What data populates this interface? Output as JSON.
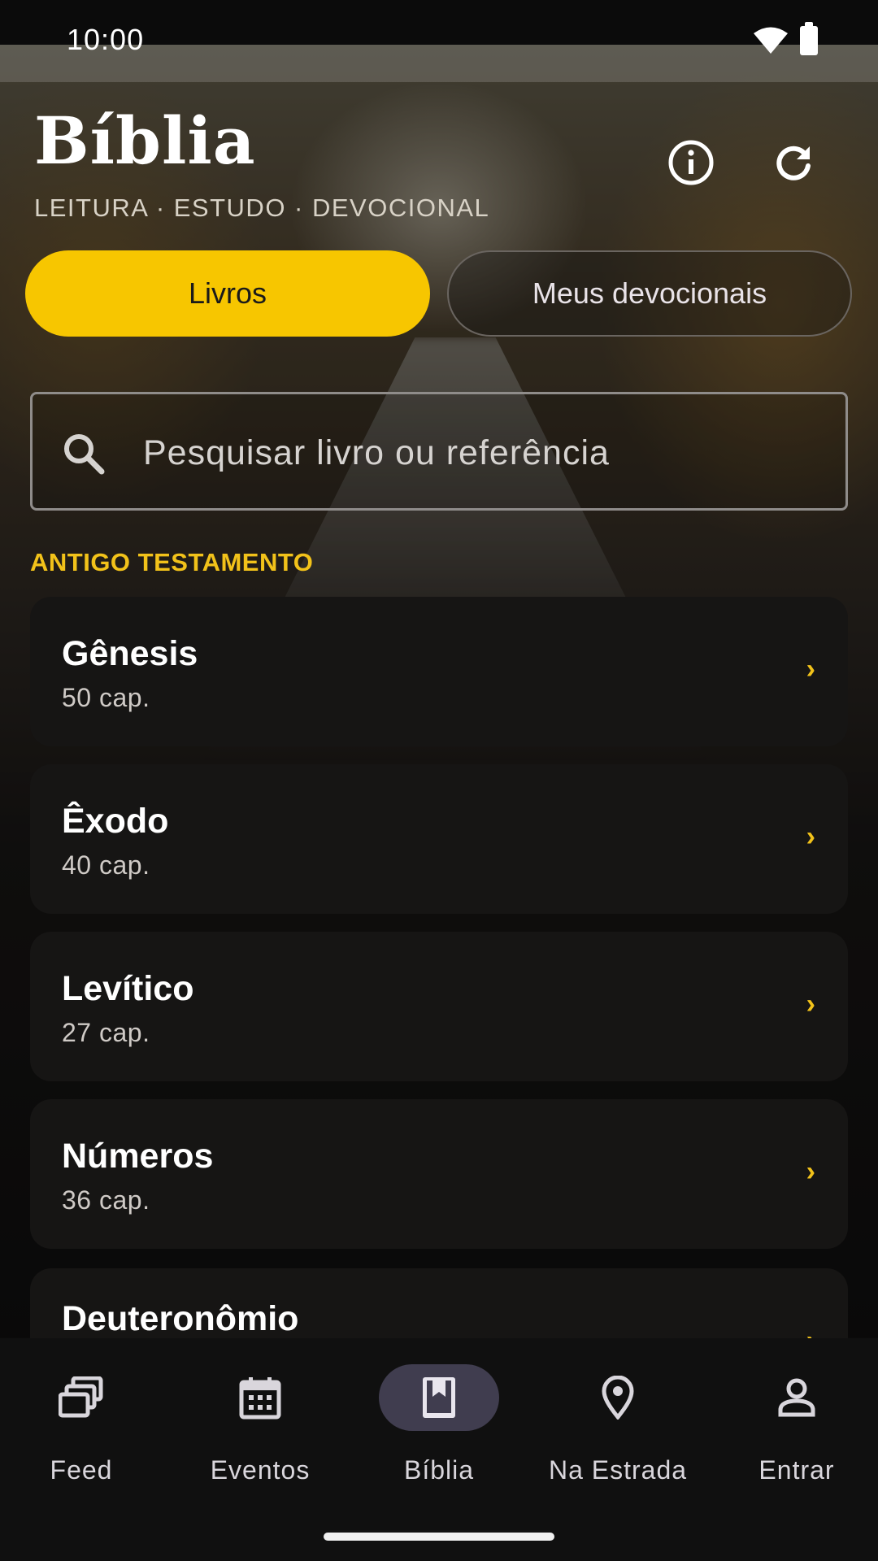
{
  "status_bar": {
    "time": "10:00"
  },
  "header": {
    "title": "Bíblia",
    "subtitle": "LEITURA · ESTUDO · DEVOCIONAL",
    "info_icon": "info-icon",
    "refresh_icon": "refresh-icon"
  },
  "tabs": [
    {
      "label": "Livros",
      "active": true
    },
    {
      "label": "Meus devocionais",
      "active": false
    }
  ],
  "search": {
    "placeholder": "Pesquisar livro ou referência",
    "icon": "search-icon"
  },
  "section": {
    "label": "ANTIGO TESTAMENTO"
  },
  "books": [
    {
      "name": "Gênesis",
      "chapters": "50 cap."
    },
    {
      "name": "Êxodo",
      "chapters": "40 cap."
    },
    {
      "name": "Levítico",
      "chapters": "27 cap."
    },
    {
      "name": "Números",
      "chapters": "36 cap."
    },
    {
      "name": "Deuteronômio",
      "chapters": ""
    }
  ],
  "bottom_nav": [
    {
      "label": "Feed",
      "icon": "feed-icon"
    },
    {
      "label": "Eventos",
      "icon": "calendar-icon"
    },
    {
      "label": "Bíblia",
      "icon": "book-icon",
      "active": true
    },
    {
      "label": "Na Estrada",
      "icon": "location-pin-icon"
    },
    {
      "label": "Entrar",
      "icon": "person-icon"
    }
  ],
  "colors": {
    "accent": "#f7c600",
    "card": "#161514",
    "nav_active": "#403d4f"
  }
}
